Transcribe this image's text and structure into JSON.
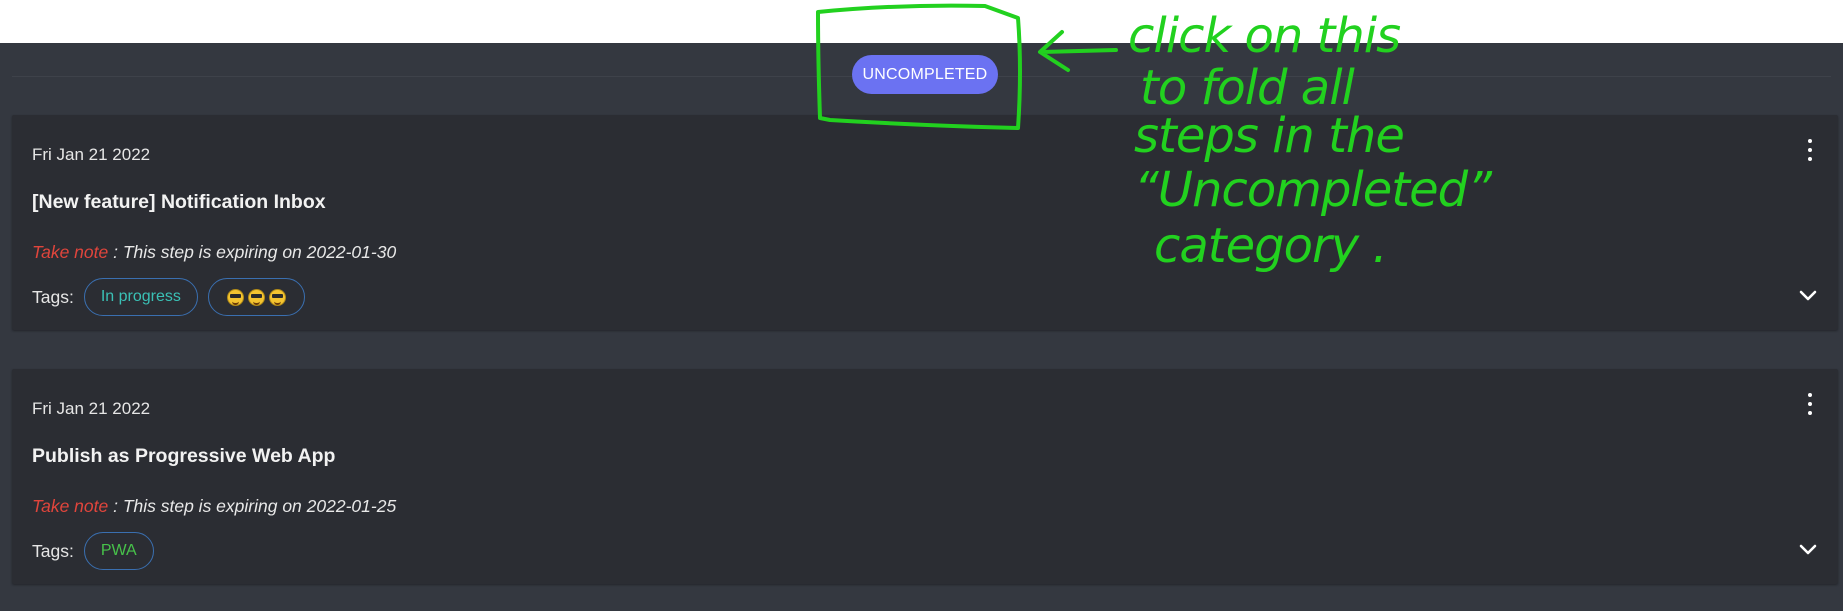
{
  "filter_chip": {
    "label": "UNCOMPLETED"
  },
  "cards": [
    {
      "date": "Fri Jan 21 2022",
      "title": "[New feature] Notification Inbox",
      "note_prefix": "Take note",
      "note_text": " : This step is expiring on 2022-01-30",
      "tags_label": "Tags:",
      "tags": [
        "In progress"
      ],
      "emoji_tag": [
        "sunglasses-emoji",
        "sunglasses-emoji",
        "sunglasses-emoji"
      ]
    },
    {
      "date": "Fri Jan 21 2022",
      "title": "Publish as Progressive Web App",
      "note_prefix": "Take note",
      "note_text": " : This step is expiring on 2022-01-25",
      "tags_label": "Tags:",
      "tags": [
        "PWA"
      ]
    }
  ],
  "annotation": {
    "lines": [
      "click on this",
      "to fold all",
      "steps in the",
      "“Uncompleted”",
      "category ."
    ]
  },
  "colors": {
    "page_bg": "#343840",
    "card_bg": "#2b2d33",
    "chip_bg": "#6b72f2",
    "warning": "#e0453c",
    "tag_teal": "#3ac0b5",
    "tag_green": "#47c24a",
    "annotation": "#22d11f"
  }
}
